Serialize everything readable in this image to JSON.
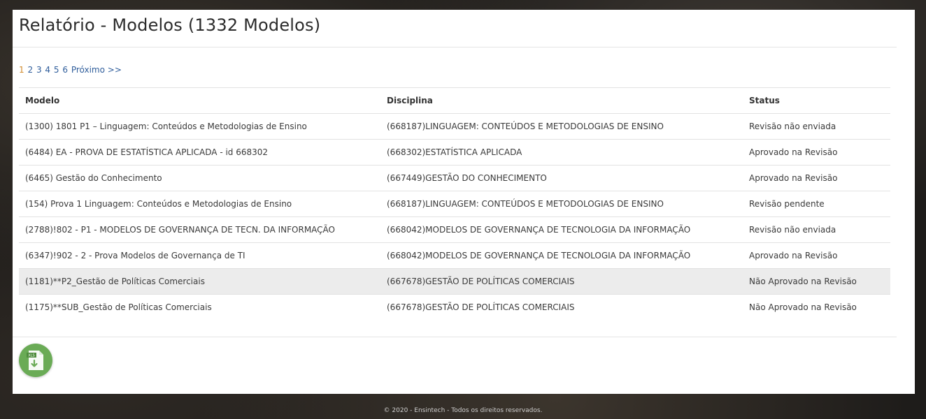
{
  "header": {
    "title": "Relatório - Modelos (1332 Modelos)"
  },
  "pagination": {
    "pages": [
      "1",
      "2",
      "3",
      "4",
      "5",
      "6"
    ],
    "next_label": "Próximo >>",
    "current": "1"
  },
  "table": {
    "headers": [
      "Modelo",
      "Disciplina",
      "Status"
    ],
    "rows": [
      [
        "(1300) 1801 P1 – Linguagem: Conteúdos e Metodologias de Ensino",
        "(668187)LINGUAGEM: CONTEÚDOS E METODOLOGIAS DE ENSINO",
        "Revisão não enviada"
      ],
      [
        "(6484) EA - PROVA DE ESTATÍSTICA APLICADA - id 668302",
        "(668302)ESTATÍSTICA APLICADA",
        "Aprovado na Revisão"
      ],
      [
        "(6465) Gestão do Conhecimento",
        "(667449)GESTÃO DO CONHECIMENTO",
        "Aprovado na Revisão"
      ],
      [
        "(154) Prova 1 Linguagem: Conteúdos e Metodologias de Ensino",
        "(668187)LINGUAGEM: CONTEÚDOS E METODOLOGIAS DE ENSINO",
        "Revisão pendente"
      ],
      [
        "(2788)!802 - P1 - MODELOS DE GOVERNANÇA DE TECN. DA INFORMAÇÃO",
        "(668042)MODELOS DE GOVERNANÇA DE TECNOLOGIA DA INFORMAÇÃO",
        "Revisão não enviada"
      ],
      [
        "(6347)!902 - 2 - Prova Modelos de Governança de TI",
        "(668042)MODELOS DE GOVERNANÇA DE TECNOLOGIA DA INFORMAÇÃO",
        "Aprovado na Revisão"
      ],
      [
        "(1181)**P2_Gestão de Políticas Comerciais",
        "(667678)GESTÃO DE POLÍTICAS COMERCIAIS",
        "Não Aprovado na Revisão"
      ],
      [
        "(1175)**SUB_Gestão de Políticas Comerciais",
        "(667678)GESTÃO DE POLÍTICAS COMERCIAIS",
        "Não Aprovado na Revisão"
      ]
    ],
    "highlighted_row": 6
  },
  "export": {
    "icon": "xls-file-download-icon",
    "badge_text": "XLS",
    "color": "#6aab56"
  },
  "footer": {
    "text": "© 2020 - Ensintech - Todos os direitos reservados."
  },
  "colors": {
    "link": "#2f5d9b",
    "current_page": "#d08a2b",
    "row_highlight": "#ececec"
  }
}
